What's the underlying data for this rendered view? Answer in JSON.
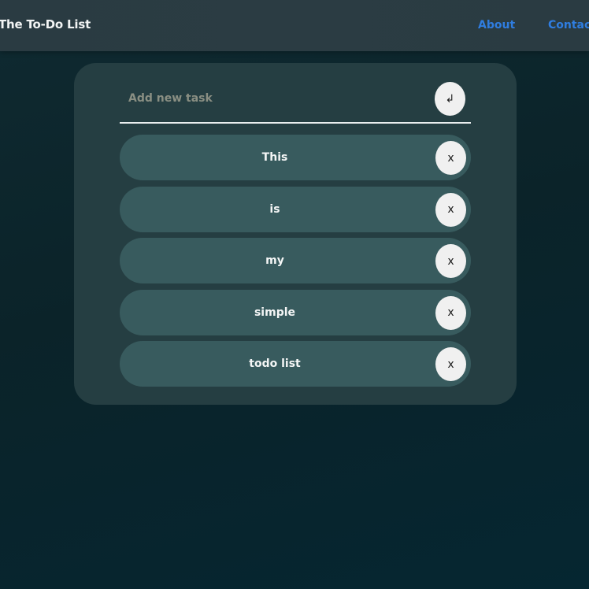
{
  "navbar": {
    "brand": "The To-Do List",
    "links": [
      {
        "label": "About"
      },
      {
        "label": "Contact"
      }
    ]
  },
  "todo": {
    "input": {
      "placeholder": "Add new task",
      "value": ""
    },
    "add_button_icon": "↲",
    "delete_button_label": "x",
    "tasks": [
      {
        "text": "This"
      },
      {
        "text": "is"
      },
      {
        "text": "my"
      },
      {
        "text": "simple"
      },
      {
        "text": "todo list"
      }
    ]
  },
  "colors": {
    "background": "#0b2329",
    "navbar": "#2b3c43",
    "card": "#253e42",
    "task_pill": "#385b5e",
    "link": "#2f7de0",
    "button": "#f0f0f0"
  }
}
